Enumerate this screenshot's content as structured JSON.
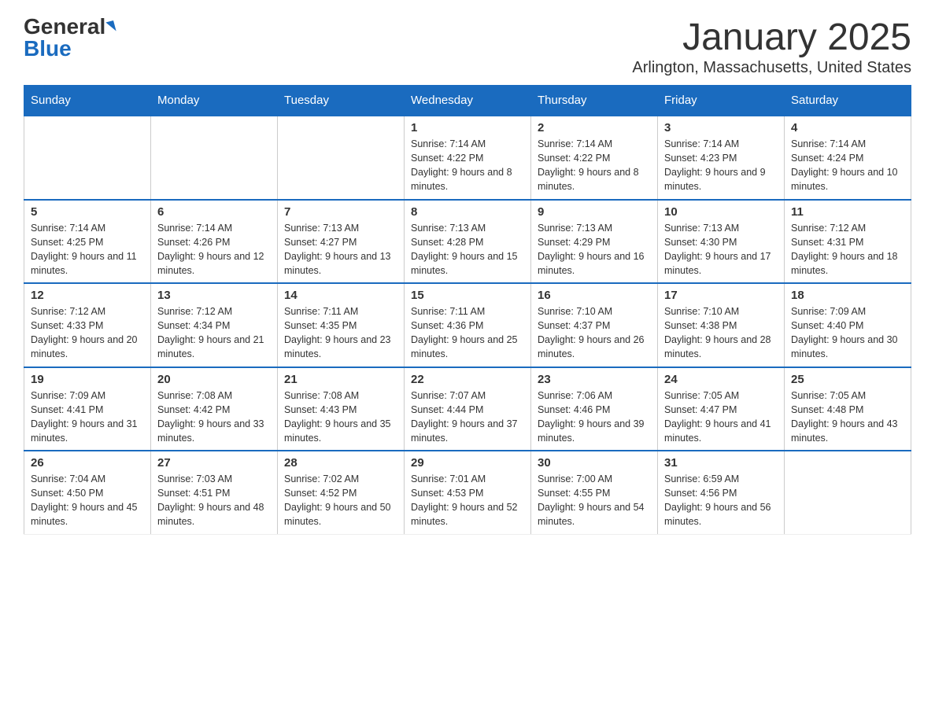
{
  "header": {
    "logo_general": "General",
    "logo_blue": "Blue",
    "month_title": "January 2025",
    "location": "Arlington, Massachusetts, United States"
  },
  "days_of_week": [
    "Sunday",
    "Monday",
    "Tuesday",
    "Wednesday",
    "Thursday",
    "Friday",
    "Saturday"
  ],
  "weeks": [
    {
      "days": [
        {
          "number": "",
          "info": ""
        },
        {
          "number": "",
          "info": ""
        },
        {
          "number": "",
          "info": ""
        },
        {
          "number": "1",
          "info": "Sunrise: 7:14 AM\nSunset: 4:22 PM\nDaylight: 9 hours and 8 minutes."
        },
        {
          "number": "2",
          "info": "Sunrise: 7:14 AM\nSunset: 4:22 PM\nDaylight: 9 hours and 8 minutes."
        },
        {
          "number": "3",
          "info": "Sunrise: 7:14 AM\nSunset: 4:23 PM\nDaylight: 9 hours and 9 minutes."
        },
        {
          "number": "4",
          "info": "Sunrise: 7:14 AM\nSunset: 4:24 PM\nDaylight: 9 hours and 10 minutes."
        }
      ]
    },
    {
      "days": [
        {
          "number": "5",
          "info": "Sunrise: 7:14 AM\nSunset: 4:25 PM\nDaylight: 9 hours and 11 minutes."
        },
        {
          "number": "6",
          "info": "Sunrise: 7:14 AM\nSunset: 4:26 PM\nDaylight: 9 hours and 12 minutes."
        },
        {
          "number": "7",
          "info": "Sunrise: 7:13 AM\nSunset: 4:27 PM\nDaylight: 9 hours and 13 minutes."
        },
        {
          "number": "8",
          "info": "Sunrise: 7:13 AM\nSunset: 4:28 PM\nDaylight: 9 hours and 15 minutes."
        },
        {
          "number": "9",
          "info": "Sunrise: 7:13 AM\nSunset: 4:29 PM\nDaylight: 9 hours and 16 minutes."
        },
        {
          "number": "10",
          "info": "Sunrise: 7:13 AM\nSunset: 4:30 PM\nDaylight: 9 hours and 17 minutes."
        },
        {
          "number": "11",
          "info": "Sunrise: 7:12 AM\nSunset: 4:31 PM\nDaylight: 9 hours and 18 minutes."
        }
      ]
    },
    {
      "days": [
        {
          "number": "12",
          "info": "Sunrise: 7:12 AM\nSunset: 4:33 PM\nDaylight: 9 hours and 20 minutes."
        },
        {
          "number": "13",
          "info": "Sunrise: 7:12 AM\nSunset: 4:34 PM\nDaylight: 9 hours and 21 minutes."
        },
        {
          "number": "14",
          "info": "Sunrise: 7:11 AM\nSunset: 4:35 PM\nDaylight: 9 hours and 23 minutes."
        },
        {
          "number": "15",
          "info": "Sunrise: 7:11 AM\nSunset: 4:36 PM\nDaylight: 9 hours and 25 minutes."
        },
        {
          "number": "16",
          "info": "Sunrise: 7:10 AM\nSunset: 4:37 PM\nDaylight: 9 hours and 26 minutes."
        },
        {
          "number": "17",
          "info": "Sunrise: 7:10 AM\nSunset: 4:38 PM\nDaylight: 9 hours and 28 minutes."
        },
        {
          "number": "18",
          "info": "Sunrise: 7:09 AM\nSunset: 4:40 PM\nDaylight: 9 hours and 30 minutes."
        }
      ]
    },
    {
      "days": [
        {
          "number": "19",
          "info": "Sunrise: 7:09 AM\nSunset: 4:41 PM\nDaylight: 9 hours and 31 minutes."
        },
        {
          "number": "20",
          "info": "Sunrise: 7:08 AM\nSunset: 4:42 PM\nDaylight: 9 hours and 33 minutes."
        },
        {
          "number": "21",
          "info": "Sunrise: 7:08 AM\nSunset: 4:43 PM\nDaylight: 9 hours and 35 minutes."
        },
        {
          "number": "22",
          "info": "Sunrise: 7:07 AM\nSunset: 4:44 PM\nDaylight: 9 hours and 37 minutes."
        },
        {
          "number": "23",
          "info": "Sunrise: 7:06 AM\nSunset: 4:46 PM\nDaylight: 9 hours and 39 minutes."
        },
        {
          "number": "24",
          "info": "Sunrise: 7:05 AM\nSunset: 4:47 PM\nDaylight: 9 hours and 41 minutes."
        },
        {
          "number": "25",
          "info": "Sunrise: 7:05 AM\nSunset: 4:48 PM\nDaylight: 9 hours and 43 minutes."
        }
      ]
    },
    {
      "days": [
        {
          "number": "26",
          "info": "Sunrise: 7:04 AM\nSunset: 4:50 PM\nDaylight: 9 hours and 45 minutes."
        },
        {
          "number": "27",
          "info": "Sunrise: 7:03 AM\nSunset: 4:51 PM\nDaylight: 9 hours and 48 minutes."
        },
        {
          "number": "28",
          "info": "Sunrise: 7:02 AM\nSunset: 4:52 PM\nDaylight: 9 hours and 50 minutes."
        },
        {
          "number": "29",
          "info": "Sunrise: 7:01 AM\nSunset: 4:53 PM\nDaylight: 9 hours and 52 minutes."
        },
        {
          "number": "30",
          "info": "Sunrise: 7:00 AM\nSunset: 4:55 PM\nDaylight: 9 hours and 54 minutes."
        },
        {
          "number": "31",
          "info": "Sunrise: 6:59 AM\nSunset: 4:56 PM\nDaylight: 9 hours and 56 minutes."
        },
        {
          "number": "",
          "info": ""
        }
      ]
    }
  ]
}
